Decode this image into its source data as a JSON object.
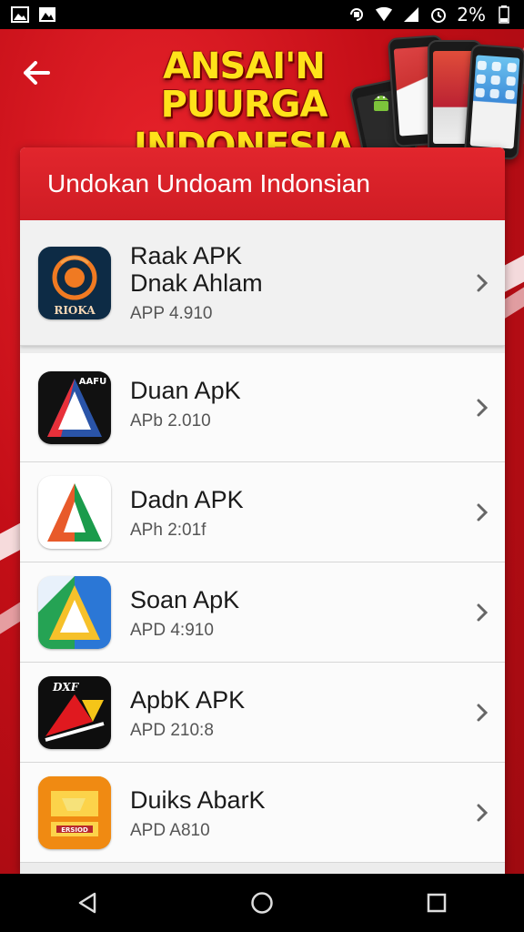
{
  "status_bar": {
    "left_icons": [
      "image-icon",
      "image-icon"
    ],
    "right_icons": [
      "rotate-lock-icon",
      "wifi-icon",
      "signal-icon",
      "alarm-icon"
    ],
    "battery_text": "2%",
    "battery_icon": "battery-icon"
  },
  "header": {
    "back_icon": "arrow-left-icon",
    "banner_line1": "ANSAI'N PUURGA",
    "banner_line2": "INDONESIA"
  },
  "panel": {
    "title": "Undokan Undoam Indonsian",
    "apps": [
      {
        "name": "Raak APK\nDnak Ahlam",
        "name_line1": "Raak APK",
        "name_line2": "Dnak Ahlam",
        "version": "APP 4.910",
        "icon_text": "RIOKA"
      },
      {
        "name": "Duan ApK",
        "version": "APb 2.010",
        "icon_text": "AAFU"
      },
      {
        "name": "Dadn APK",
        "version": "APh 2:01f"
      },
      {
        "name": "Soan ApK",
        "version": "APD 4:910"
      },
      {
        "name": "ApbK APK",
        "version": "APD 210:8",
        "icon_text": "DXF"
      },
      {
        "name": "Duiks AbarK",
        "version": "APD A810",
        "icon_text": "ERSIOD"
      }
    ]
  },
  "nav_bar": {
    "back_icon": "triangle-back-icon",
    "home_icon": "circle-home-icon",
    "recents_icon": "square-recents-icon"
  },
  "colors": {
    "accent_red": "#d41f27",
    "banner_yellow": "#ffe21a"
  }
}
